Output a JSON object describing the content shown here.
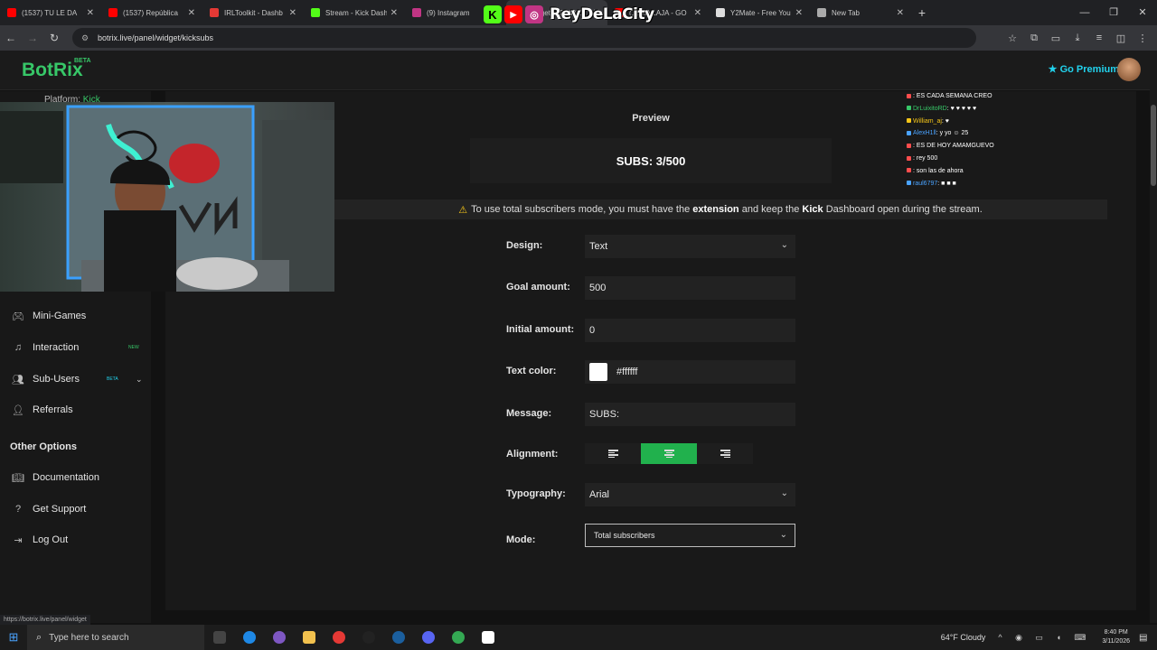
{
  "browser": {
    "tabs": [
      {
        "label": "(1537) TU LE DA",
        "color": "#ff0000"
      },
      {
        "label": "(1537) República",
        "color": "#ff0000"
      },
      {
        "label": "IRLToolkit - Dashb",
        "color": "#e53935"
      },
      {
        "label": "Stream - Kick Dash",
        "color": "#53fc18"
      },
      {
        "label": "(9) Instagram",
        "color": "#c13584"
      },
      {
        "label": "Widgets | BotRix",
        "color": "#37c768",
        "active": true
      },
      {
        "label": "(1537) LAJA - GO",
        "color": "#ff0000"
      },
      {
        "label": "Y2Mate - Free You",
        "color": "#dddddd"
      },
      {
        "label": "New Tab",
        "color": "#aaaaaa"
      }
    ],
    "url": "botrix.live/panel/widget/kicksubs",
    "status_url": "https://botrix.live/panel/widget"
  },
  "overlay": {
    "channel_name": "ReyDeLaCity"
  },
  "header": {
    "logo": "BotRix",
    "logo_badge": "BETA",
    "premium_label": "Go Premium"
  },
  "sidebar": {
    "platform_label": "Platform:",
    "platform_value": "Kick",
    "items": [
      {
        "label": "Mini-Games",
        "icon": "gamepad-icon"
      },
      {
        "label": "Interaction",
        "icon": "music-note-icon",
        "tag": "NEW"
      },
      {
        "label": "Sub-Users",
        "icon": "users-icon",
        "tag": "BETA"
      },
      {
        "label": "Referrals",
        "icon": "people-group-icon"
      }
    ],
    "other_title": "Other Options",
    "other_items": [
      {
        "label": "Documentation",
        "icon": "book-icon"
      },
      {
        "label": "Get Support",
        "icon": "question-icon"
      },
      {
        "label": "Log Out",
        "icon": "logout-icon"
      }
    ]
  },
  "main": {
    "preview_title": "Preview",
    "preview_text": "SUBS: 3/500",
    "notice": {
      "prefix": "To use total subscribers mode, you must have the",
      "bold1": "extension",
      "mid": "and keep the",
      "bold2": "Kick",
      "suffix": "Dashboard open during the stream."
    },
    "form": {
      "design_label": "Design:",
      "design_value": "Text",
      "goal_label": "Goal amount:",
      "goal_value": "500",
      "initial_label": "Initial amount:",
      "initial_value": "0",
      "color_label": "Text color:",
      "color_value": "#ffffff",
      "message_label": "Message:",
      "message_value": "SUBS:",
      "alignment_label": "Alignment:",
      "alignment_selected": "center",
      "typography_label": "Typography:",
      "typography_value": "Arial",
      "mode_label": "Mode:",
      "mode_value": "Total subscribers"
    }
  },
  "chat": [
    {
      "user": "",
      "msg": ": ES CADA SEMANA CREO",
      "color": "#ff4d4d"
    },
    {
      "user": "DrLuixitoRD",
      "msg": ": ♥ ♥ ♥ ♥ ♥",
      "color": "#37c768"
    },
    {
      "user": "William_aj",
      "msg": ": ♥",
      "color": "#f5c518"
    },
    {
      "user": "AlexH1ll",
      "msg": ": y yo ☺ 25",
      "color": "#4aa3ff"
    },
    {
      "user": "",
      "msg": ": ES DE HOY AMAMGUEVO",
      "color": "#ff4d4d"
    },
    {
      "user": "",
      "msg": ": rey 500",
      "color": "#ff4d4d"
    },
    {
      "user": "",
      "msg": ": son las de ahora",
      "color": "#ff4d4d"
    },
    {
      "user": "raul6797",
      "msg": ": ■ ■ ■",
      "color": "#4aa3ff"
    }
  ],
  "taskbar": {
    "search_placeholder": "Type here to search",
    "weather": "64°F  Cloudy",
    "time": "8:40 PM",
    "date": "3/11/2026"
  },
  "colors": {
    "accent": "#37c768",
    "premium": "#22d3ee",
    "warning": "#f5c518"
  }
}
